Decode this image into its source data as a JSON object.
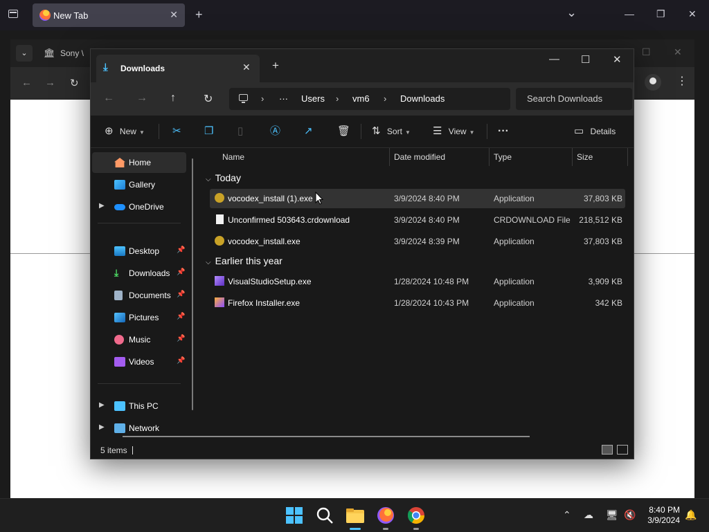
{
  "firefox": {
    "tab_title": "New Tab",
    "tab_close": "✕",
    "new_tab": "+",
    "list_all_tabs": "⌄",
    "minimize": "—",
    "maximize": "❐",
    "close": "✕"
  },
  "background_window": {
    "tab_title": "Sony \\",
    "menu": "⌄",
    "back": "←",
    "forward": "→",
    "reload": "↻",
    "more": "⋮",
    "minimize": "—",
    "maximize": "☐",
    "close": "✕"
  },
  "explorer": {
    "tab_title": "Downloads",
    "tab_close": "✕",
    "new_tab": "+",
    "minimize": "—",
    "maximize": "☐",
    "close": "✕",
    "nav": {
      "back": "←",
      "forward": "→",
      "up": "↑",
      "refresh": "↻"
    },
    "breadcrumb": [
      "Users",
      "vm6",
      "Downloads"
    ],
    "breadcrumb_more": "···",
    "search_placeholder": "Search Downloads",
    "toolbar": {
      "new_label": "New",
      "sort_label": "Sort",
      "view_label": "View",
      "more": "···",
      "details_label": "Details"
    },
    "nav_pane": [
      {
        "label": "Home",
        "selected": true,
        "pinned": false,
        "expandable": false,
        "icon": "home-icon"
      },
      {
        "label": "Gallery",
        "selected": false,
        "pinned": false,
        "expandable": false,
        "icon": "gallery-icon"
      },
      {
        "label": "OneDrive",
        "selected": false,
        "pinned": false,
        "expandable": true,
        "icon": "cloud-icon"
      },
      {
        "label": "Desktop",
        "selected": false,
        "pinned": true,
        "expandable": false,
        "icon": "desktop-icon"
      },
      {
        "label": "Downloads",
        "selected": false,
        "pinned": true,
        "expandable": false,
        "icon": "download-icon"
      },
      {
        "label": "Documents",
        "selected": false,
        "pinned": true,
        "expandable": false,
        "icon": "documents-icon"
      },
      {
        "label": "Pictures",
        "selected": false,
        "pinned": true,
        "expandable": false,
        "icon": "pictures-icon"
      },
      {
        "label": "Music",
        "selected": false,
        "pinned": true,
        "expandable": false,
        "icon": "music-icon"
      },
      {
        "label": "Videos",
        "selected": false,
        "pinned": true,
        "expandable": false,
        "icon": "videos-icon"
      },
      {
        "label": "This PC",
        "selected": false,
        "pinned": false,
        "expandable": true,
        "icon": "pc-icon"
      },
      {
        "label": "Network",
        "selected": false,
        "pinned": false,
        "expandable": true,
        "icon": "network-icon"
      }
    ],
    "columns": [
      "Name",
      "Date modified",
      "Type",
      "Size"
    ],
    "groups": [
      {
        "label": "Today",
        "files": [
          {
            "name": "vocodex_install (1).exe",
            "date": "3/9/2024 8:40 PM",
            "type": "Application",
            "size": "37,803 KB",
            "icon": "installer-icon"
          },
          {
            "name": "Unconfirmed 503643.crdownload",
            "date": "3/9/2024 8:40 PM",
            "type": "CRDOWNLOAD File",
            "size": "218,512 KB",
            "icon": "file-icon"
          },
          {
            "name": "vocodex_install.exe",
            "date": "3/9/2024 8:39 PM",
            "type": "Application",
            "size": "37,803 KB",
            "icon": "installer-icon"
          }
        ]
      },
      {
        "label": "Earlier this year",
        "files": [
          {
            "name": "VisualStudioSetup.exe",
            "date": "1/28/2024 10:48 PM",
            "type": "Application",
            "size": "3,909 KB",
            "icon": "visual-studio-icon"
          },
          {
            "name": "Firefox Installer.exe",
            "date": "1/28/2024 10:43 PM",
            "type": "Application",
            "size": "342 KB",
            "icon": "firefox-installer-icon"
          }
        ]
      }
    ],
    "status_text": "5 items"
  },
  "taskbar": {
    "clock_time": "8:40 PM",
    "clock_date": "3/9/2024",
    "overflow": "⌃"
  },
  "colors": {
    "accent": "#4cc2ff",
    "window_bg": "#191919",
    "selected_bg": "#2d2d2d"
  }
}
